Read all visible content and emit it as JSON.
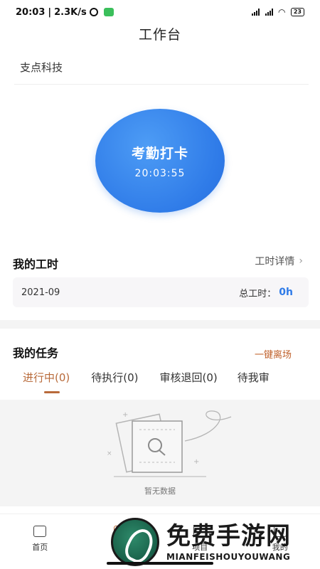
{
  "status_bar": {
    "time": "20:03",
    "net_speed": "2.3K/s",
    "battery": "23"
  },
  "header": {
    "title": "工作台"
  },
  "company": {
    "name": "支点科技"
  },
  "clock_in": {
    "label": "考勤打卡",
    "time": "20:03:55"
  },
  "work_hours": {
    "title": "我的工时",
    "detail_link": "工时详情",
    "month": "2021-09",
    "total_label": "总工时：",
    "total_value": "0h"
  },
  "tasks": {
    "title": "我的任务",
    "leave_button": "一键离场",
    "tabs": [
      {
        "label": "进行中(0)",
        "active": true
      },
      {
        "label": "待执行(0)",
        "active": false
      },
      {
        "label": "审核退回(0)",
        "active": false
      },
      {
        "label": "待我审",
        "active": false
      }
    ],
    "empty_text": "暂无数据"
  },
  "tab_bar": {
    "items": [
      {
        "label": "首页",
        "icon": "home-icon"
      },
      {
        "label": "工作",
        "icon": "briefcase-icon"
      },
      {
        "label": "项目",
        "icon": "folder-icon"
      },
      {
        "label": "我的",
        "icon": "user-icon"
      }
    ]
  },
  "watermark": {
    "title": "免费手游网",
    "subtitle": "MIANFEISHOUYOUWANG"
  },
  "colors": {
    "accent": "#b86a3a",
    "primary_blue": "#2f7be8",
    "leave_orange": "#c0602a"
  }
}
